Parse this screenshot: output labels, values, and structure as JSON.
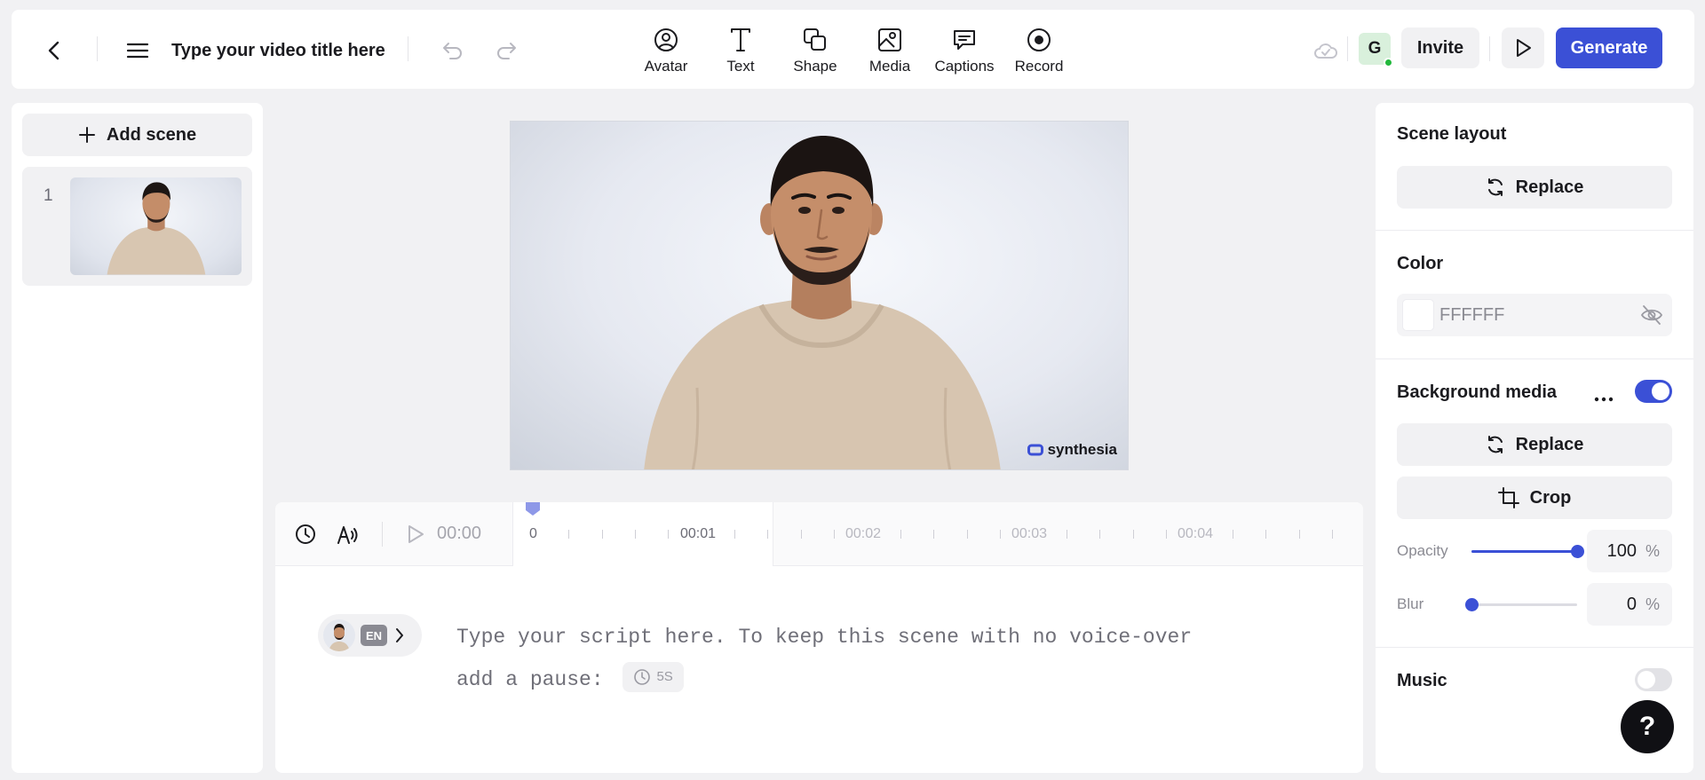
{
  "header": {
    "title_placeholder": "Type your video title here",
    "tools": [
      {
        "label": "Avatar",
        "icon": "avatar-icon"
      },
      {
        "label": "Text",
        "icon": "text-icon"
      },
      {
        "label": "Shape",
        "icon": "shape-icon"
      },
      {
        "label": "Media",
        "icon": "media-icon"
      },
      {
        "label": "Captions",
        "icon": "captions-icon"
      },
      {
        "label": "Record",
        "icon": "record-icon"
      }
    ],
    "user_initial": "G",
    "invite_label": "Invite",
    "generate_label": "Generate"
  },
  "sidebar": {
    "add_scene_label": "Add scene",
    "scenes": [
      {
        "number": "1"
      }
    ]
  },
  "preview": {
    "watermark": "synthesia"
  },
  "timeline": {
    "current_time": "00:00",
    "markers": [
      "0",
      "00:01",
      "00:02",
      "00:03",
      "00:04"
    ]
  },
  "script": {
    "language": "EN",
    "text": "Type your script here. To keep this scene with no voice-over add a pause:",
    "pause_label": "5S"
  },
  "panel": {
    "scene_layout_title": "Scene layout",
    "replace_label": "Replace",
    "color_title": "Color",
    "color_value": "FFFFFF",
    "background_media_title": "Background media",
    "background_media_enabled": true,
    "crop_label": "Crop",
    "opacity_label": "Opacity",
    "opacity_value": "100",
    "opacity_fraction": 1.0,
    "blur_label": "Blur",
    "blur_value": "0",
    "blur_fraction": 0.0,
    "percent": "%",
    "music_title": "Music",
    "music_enabled": false
  },
  "help_label": "?",
  "colors": {
    "accent": "#3b50d6",
    "background": "#f1f1f3"
  }
}
